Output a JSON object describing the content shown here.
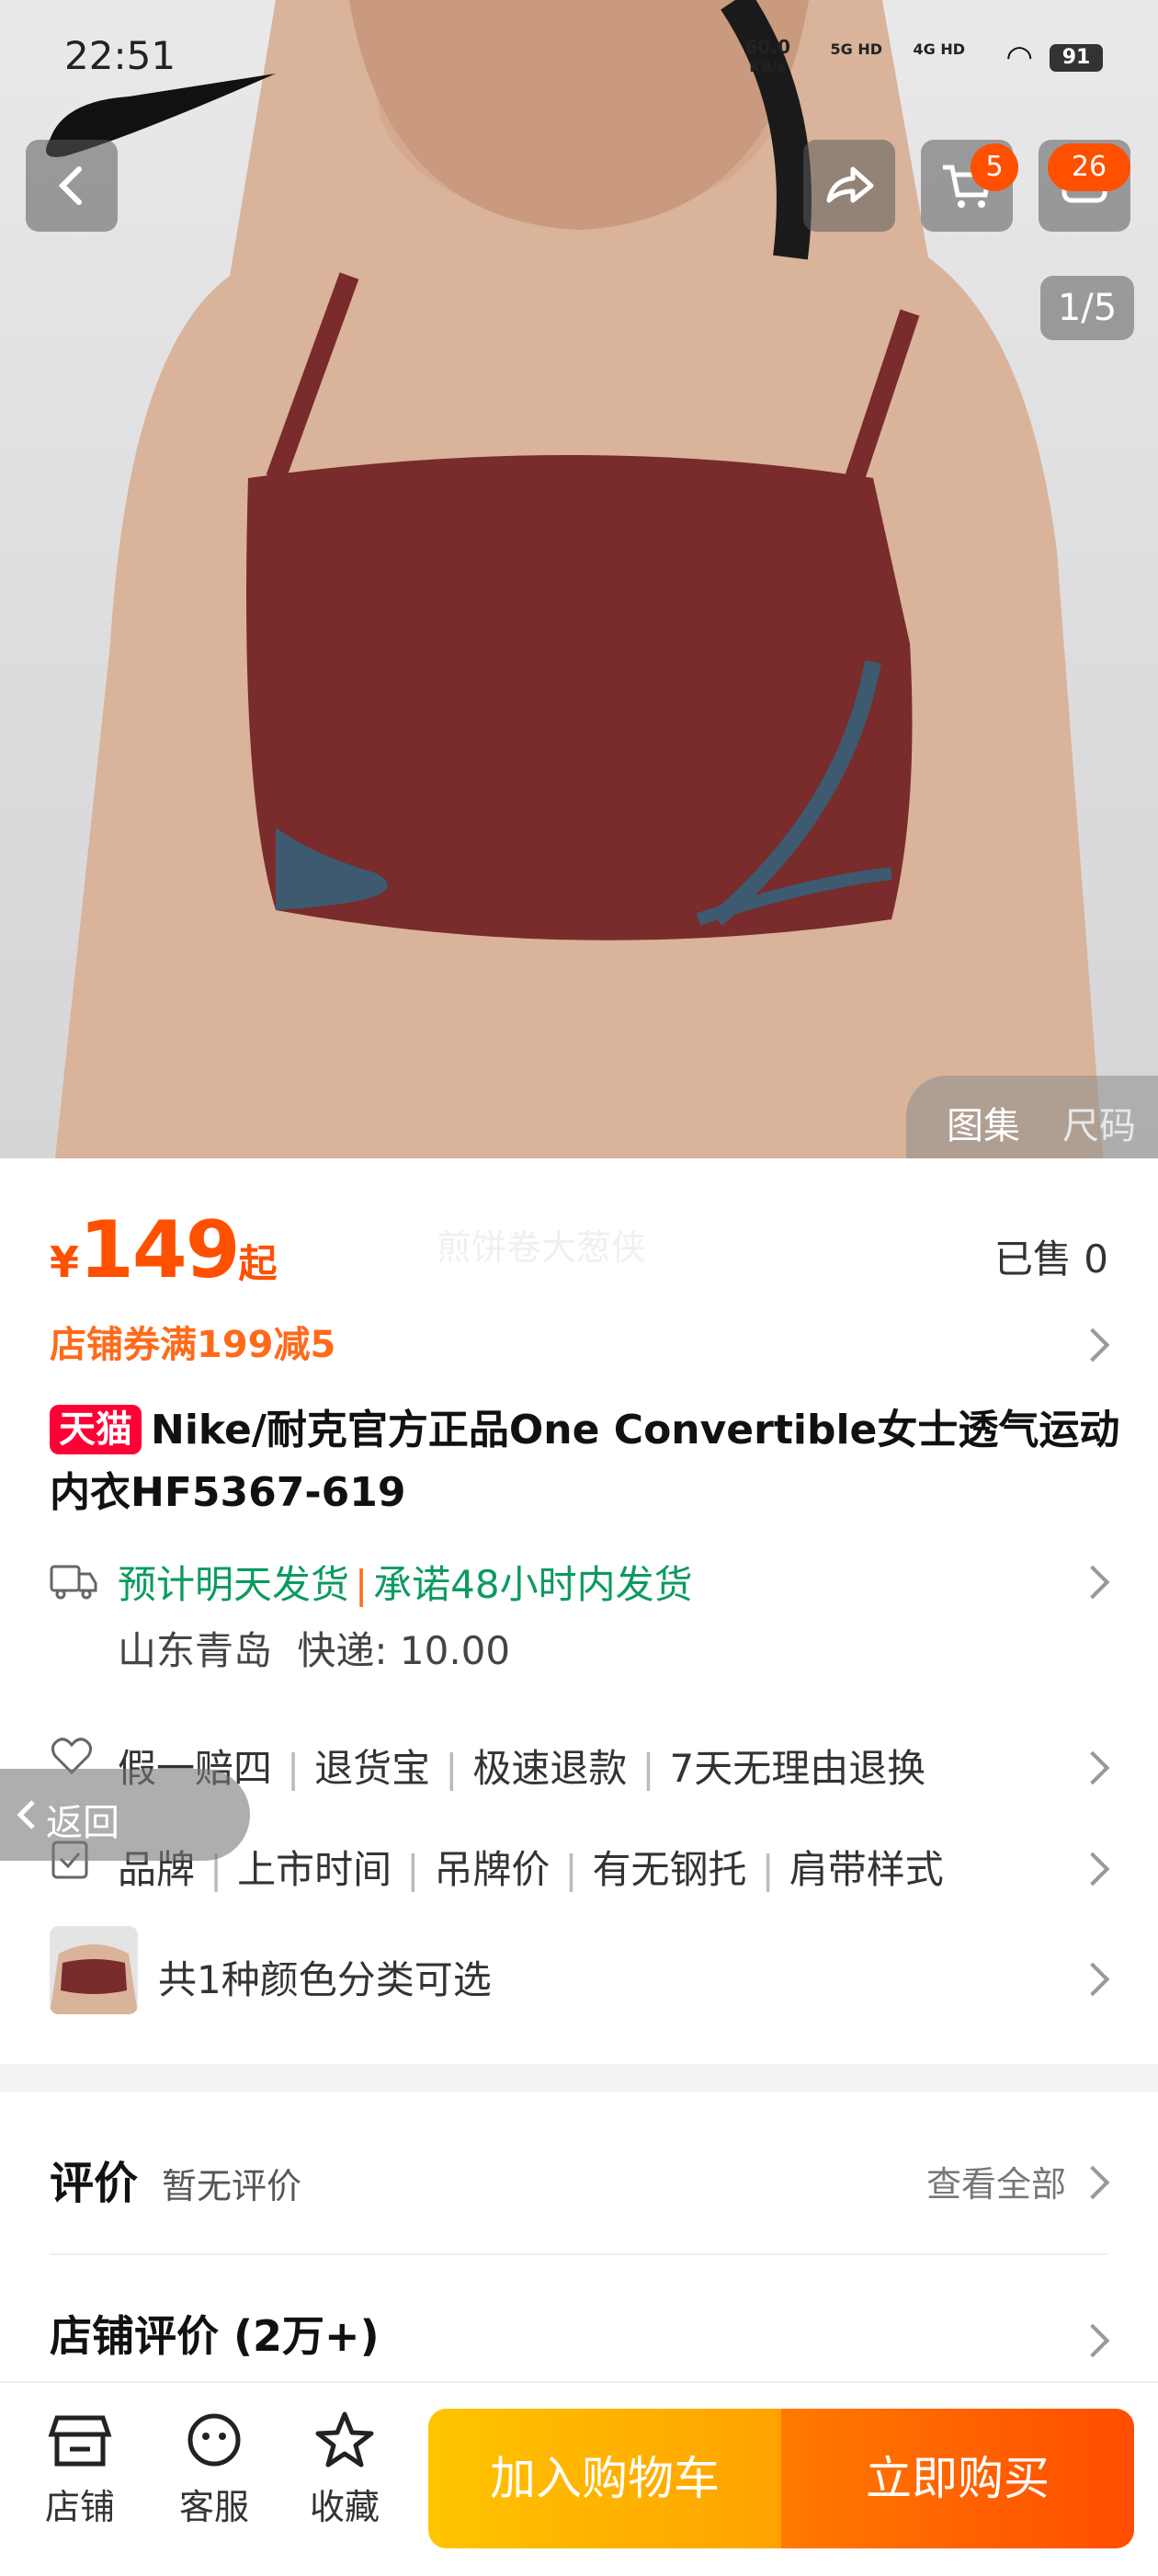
{
  "status": {
    "time": "22:51",
    "net_speed": "60.0",
    "net_unit": "KB/s",
    "sig1": "5G HD",
    "sig2": "4G HD",
    "battery": "91"
  },
  "header": {
    "cart_count": "5",
    "msg_count": "26",
    "pager": "1/5",
    "gallery_tab": "图集",
    "size_tab": "尺码"
  },
  "product": {
    "currency": "¥",
    "price": "149",
    "price_suffix": "起",
    "watermark": "煎饼卷大葱侠",
    "sold": "已售 0",
    "coupon": "店铺券满199减5",
    "tmall_tag": "天猫",
    "title": "Nike/耐克官方正品One Convertible女士透气运动内衣HF5367-619"
  },
  "shipping": {
    "line1_a": "预计明天发货",
    "sep": "|",
    "line1_b": "承诺48小时内发货",
    "origin": "山东青岛",
    "fee_label": "快递: 10.00"
  },
  "services": [
    "假一赔四",
    "退货宝",
    "极速退款",
    "7天无理由退换"
  ],
  "params": [
    "品牌",
    "上市时间",
    "吊牌价",
    "有无钢托",
    "肩带样式"
  ],
  "colors_text": "共1种颜色分类可选",
  "back_pill": "返回",
  "reviews": {
    "title": "评价",
    "empty": "暂无评价",
    "view_all": "查看全部",
    "shop_title": "店铺评价 (2万+)"
  },
  "bottom": {
    "shop": "店铺",
    "service": "客服",
    "fav": "收藏",
    "add_cart": "加入购物车",
    "buy_now": "立即购买"
  },
  "colors": {
    "accent": "#ff5000",
    "tmall": "#ff0036",
    "ship_green": "#0b9b5f",
    "garment": "#7a2b2b",
    "trim": "#3d5a70"
  }
}
